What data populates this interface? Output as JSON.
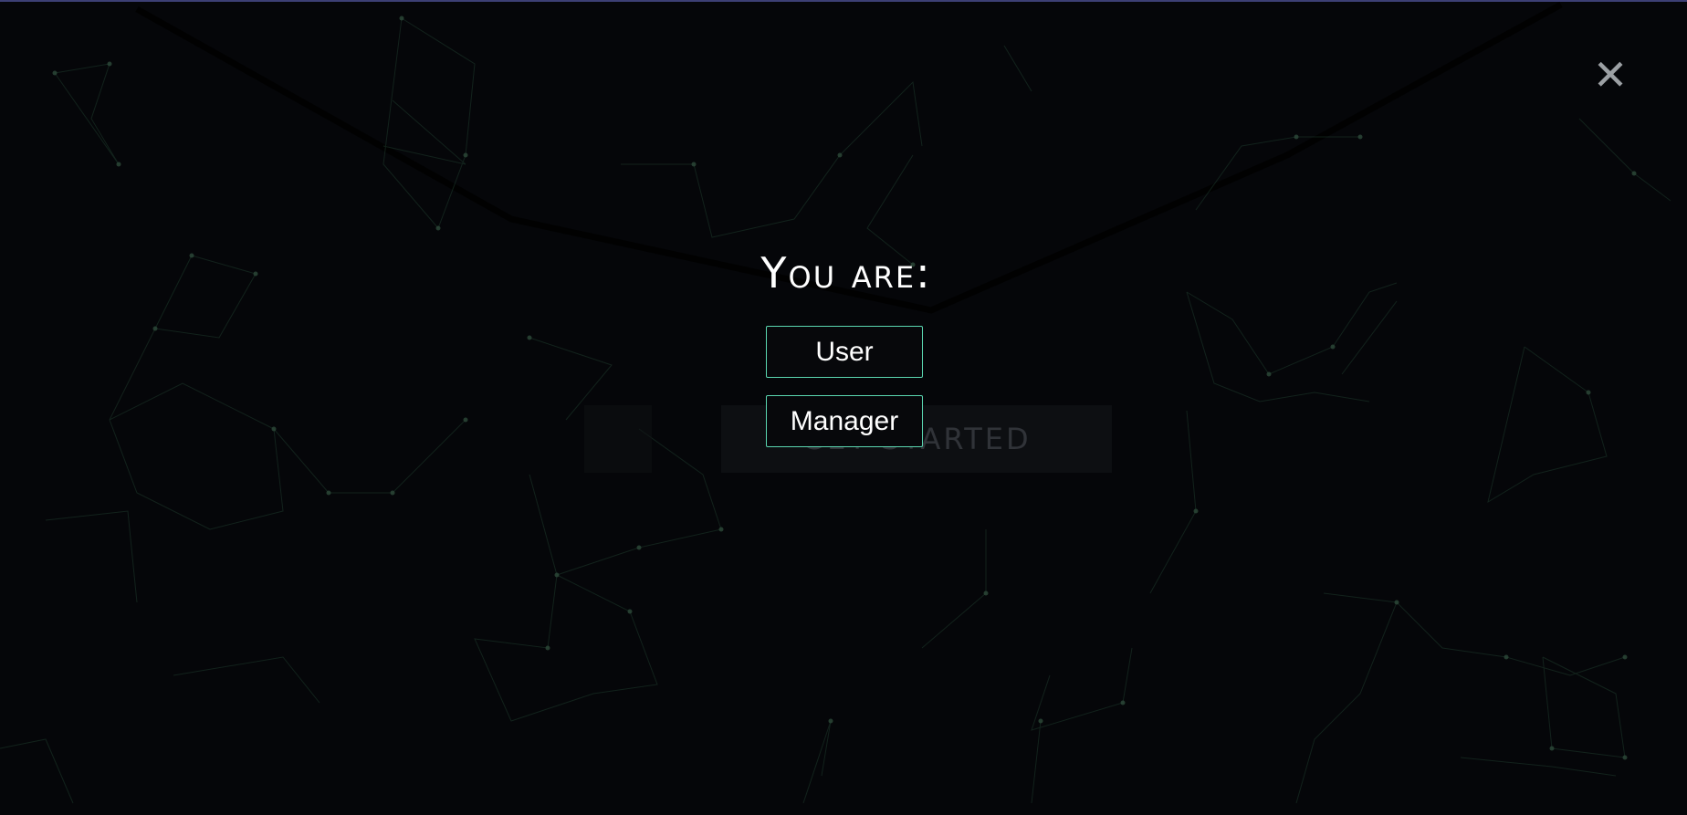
{
  "background": {
    "hero_button_text": "GET STARTED",
    "line_color": "#1e3a2c",
    "node_color": "#2d4a3a"
  },
  "modal": {
    "title": "You are:",
    "close_icon": "close-icon",
    "close_glyph": "✕",
    "options": [
      {
        "label": "User"
      },
      {
        "label": "Manager"
      }
    ],
    "accent_color": "#5ad6b0"
  }
}
